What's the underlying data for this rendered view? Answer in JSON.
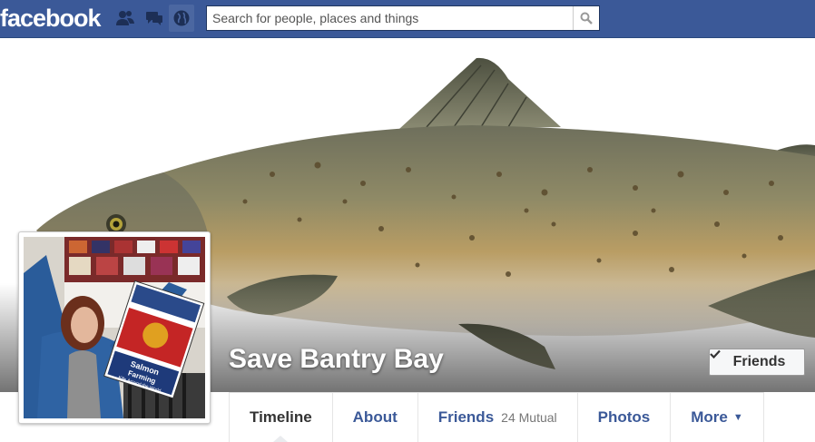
{
  "topbar": {
    "logo": "facebook",
    "search_placeholder": "Search for people, places and things"
  },
  "page": {
    "title": "Save Bantry Bay",
    "friends_button": "Friends"
  },
  "profile_sign": {
    "line1": "Salmon",
    "line2": "Farming",
    "line3": "Kills Around the World"
  },
  "nav": {
    "tabs": [
      {
        "label": "Timeline",
        "sub": ""
      },
      {
        "label": "About",
        "sub": ""
      },
      {
        "label": "Friends",
        "sub": "24 Mutual"
      },
      {
        "label": "Photos",
        "sub": ""
      },
      {
        "label": "More",
        "sub": ""
      }
    ]
  },
  "colors": {
    "brand": "#3b5998",
    "link": "#3b5998"
  },
  "icons": [
    "friend-requests-icon",
    "messages-icon",
    "notifications-globe-icon",
    "search-icon",
    "check-icon",
    "caret-down-icon"
  ]
}
